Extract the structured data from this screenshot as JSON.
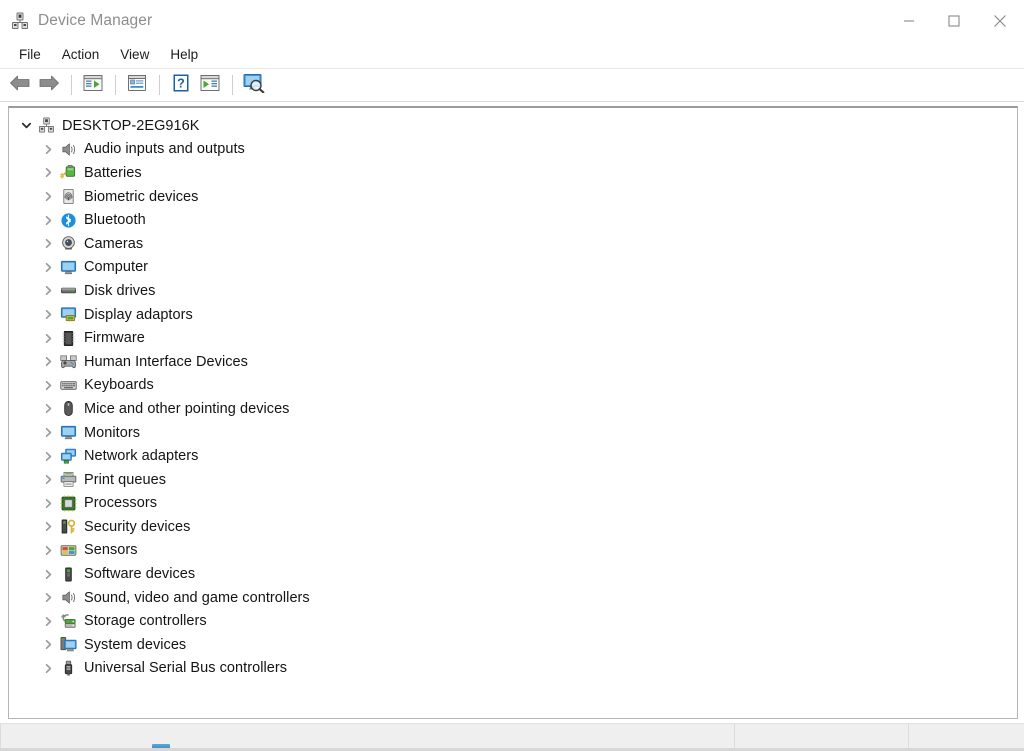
{
  "window": {
    "title": "Device Manager",
    "icon": "device-manager-icon",
    "controls": [
      {
        "name": "minimize-button",
        "glyph": "minimize"
      },
      {
        "name": "maximize-button",
        "glyph": "maximize"
      },
      {
        "name": "close-button",
        "glyph": "close"
      }
    ]
  },
  "menubar": {
    "items": [
      {
        "label": "File",
        "name": "menu-file"
      },
      {
        "label": "Action",
        "name": "menu-action"
      },
      {
        "label": "View",
        "name": "menu-view"
      },
      {
        "label": "Help",
        "name": "menu-help"
      }
    ]
  },
  "toolbar": {
    "buttons": [
      {
        "name": "back-button",
        "icon": "back-arrow-icon"
      },
      {
        "name": "forward-button",
        "icon": "forward-arrow-icon"
      },
      {
        "name": "separator-1",
        "icon": "separator"
      },
      {
        "name": "show-hide-console-tree-button",
        "icon": "console-tree-icon"
      },
      {
        "name": "separator-2",
        "icon": "separator"
      },
      {
        "name": "properties-button",
        "icon": "properties-icon"
      },
      {
        "name": "separator-3",
        "icon": "separator"
      },
      {
        "name": "help-button",
        "icon": "help-question-icon"
      },
      {
        "name": "update-driver-button",
        "icon": "update-driver-icon"
      },
      {
        "name": "separator-4",
        "icon": "separator"
      },
      {
        "name": "scan-hardware-changes-button",
        "icon": "scan-monitor-icon"
      }
    ]
  },
  "tree": {
    "root": {
      "label": "DESKTOP-2EG916K",
      "icon": "computer-root-icon",
      "expanded": true,
      "chevron": "chevron-down"
    },
    "items": [
      {
        "label": "Audio inputs and outputs",
        "icon": "speaker-icon",
        "chevron": "chevron-right"
      },
      {
        "label": "Batteries",
        "icon": "battery-icon",
        "chevron": "chevron-right"
      },
      {
        "label": "Biometric devices",
        "icon": "fingerprint-icon",
        "chevron": "chevron-right"
      },
      {
        "label": "Bluetooth",
        "icon": "bluetooth-icon",
        "chevron": "chevron-right"
      },
      {
        "label": "Cameras",
        "icon": "camera-icon",
        "chevron": "chevron-right"
      },
      {
        "label": "Computer",
        "icon": "monitor-icon",
        "chevron": "chevron-right"
      },
      {
        "label": "Disk drives",
        "icon": "disk-drive-icon",
        "chevron": "chevron-right"
      },
      {
        "label": "Display adaptors",
        "icon": "display-adapter-icon",
        "chevron": "chevron-right"
      },
      {
        "label": "Firmware",
        "icon": "firmware-chip-icon",
        "chevron": "chevron-right"
      },
      {
        "label": "Human Interface Devices",
        "icon": "gamepad-icon",
        "chevron": "chevron-right"
      },
      {
        "label": "Keyboards",
        "icon": "keyboard-icon",
        "chevron": "chevron-right"
      },
      {
        "label": "Mice and other pointing devices",
        "icon": "mouse-icon",
        "chevron": "chevron-right"
      },
      {
        "label": "Monitors",
        "icon": "monitor-icon",
        "chevron": "chevron-right"
      },
      {
        "label": "Network adapters",
        "icon": "network-adapter-icon",
        "chevron": "chevron-right"
      },
      {
        "label": "Print queues",
        "icon": "printer-icon",
        "chevron": "chevron-right"
      },
      {
        "label": "Processors",
        "icon": "processor-chip-icon",
        "chevron": "chevron-right"
      },
      {
        "label": "Security devices",
        "icon": "security-key-icon",
        "chevron": "chevron-right"
      },
      {
        "label": "Sensors",
        "icon": "sensors-grid-icon",
        "chevron": "chevron-right"
      },
      {
        "label": "Software devices",
        "icon": "software-device-icon",
        "chevron": "chevron-right"
      },
      {
        "label": "Sound, video and game controllers",
        "icon": "speaker-icon",
        "chevron": "chevron-right"
      },
      {
        "label": "Storage controllers",
        "icon": "storage-controller-icon",
        "chevron": "chevron-right"
      },
      {
        "label": "System devices",
        "icon": "system-device-icon",
        "chevron": "chevron-right"
      },
      {
        "label": "Universal Serial Bus controllers",
        "icon": "usb-icon",
        "chevron": "chevron-right"
      }
    ]
  },
  "statusbar": {
    "pane1": "",
    "pane2": "",
    "pane3": ""
  },
  "colors": {
    "title_text": "#8d8d8d",
    "body_text": "#141414",
    "window_bg": "#ffffff",
    "statusbar_bg": "#efefef",
    "panel_border": "#b5b5b5",
    "chevron": "#9a9a9a",
    "accent_blue": "#0078d7"
  }
}
